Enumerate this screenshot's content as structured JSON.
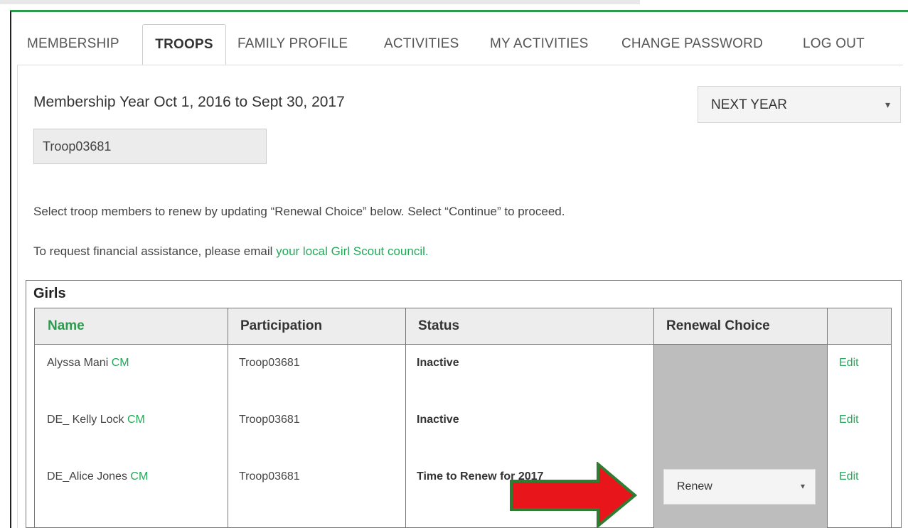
{
  "nav": {
    "tabs": [
      {
        "label": "MEMBERSHIP"
      },
      {
        "label": "TROOPS"
      },
      {
        "label": "FAMILY PROFILE"
      },
      {
        "label": "ACTIVITIES"
      },
      {
        "label": "MY ACTIVITIES"
      },
      {
        "label": "CHANGE PASSWORD"
      },
      {
        "label": "LOG OUT"
      }
    ],
    "active": "TROOPS"
  },
  "header": {
    "year_text": "Membership Year Oct 1, 2016 to Sept 30, 2017",
    "year_select": "NEXT YEAR",
    "troop_select": "Troop03681"
  },
  "instructions": {
    "line1": "Select troop members to renew by updating “Renewal Choice” below. Select “Continue” to proceed.",
    "line2_prefix": "To request financial assistance, please email ",
    "line2_link": "your local Girl Scout council."
  },
  "girls": {
    "title": "Girls",
    "columns": [
      "Name",
      "Participation",
      "Status",
      "Renewal Choice",
      ""
    ],
    "rows": [
      {
        "name": "Alyssa Mani",
        "tag": "CM",
        "participation": "Troop03681",
        "status": "Inactive",
        "renewal": "",
        "action": "Edit"
      },
      {
        "name": "DE_ Kelly Lock",
        "tag": "CM",
        "participation": "Troop03681",
        "status": "Inactive",
        "renewal": "",
        "action": "Edit"
      },
      {
        "name": "DE_Alice Jones",
        "tag": "CM",
        "participation": "Troop03681",
        "status": "Time to Renew for 2017",
        "renewal": "Renew",
        "action": "Edit"
      }
    ]
  },
  "colors": {
    "accent_green": "#2e9a4e",
    "link_green": "#25a85a",
    "arrow_red": "#e8161b",
    "arrow_border": "#2e7d32",
    "renewal_column_bg": "#bdbdbd"
  },
  "icons": {
    "dropdown": "caret-down-icon",
    "annotation": "right-arrow-icon"
  }
}
